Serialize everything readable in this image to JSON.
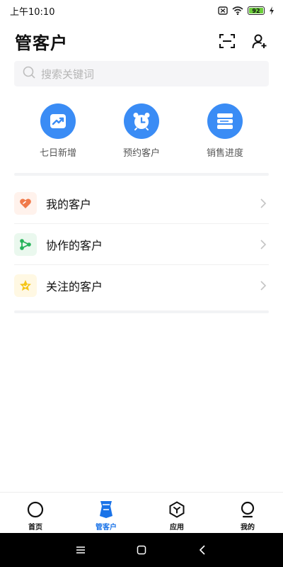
{
  "status_bar": {
    "time": "上午10:10",
    "battery": "92"
  },
  "header": {
    "title": "管客户"
  },
  "search": {
    "placeholder": "搜索关键词"
  },
  "quick_actions": [
    {
      "label": "七日新增",
      "icon": "trend-chart-icon"
    },
    {
      "label": "预约客户",
      "icon": "alarm-clock-icon"
    },
    {
      "label": "销售进度",
      "icon": "layers-icon"
    }
  ],
  "list": [
    {
      "label": "我的客户",
      "icon": "heart-tag-icon",
      "icon_color": "#f07a4b",
      "icon_bg": "#fff2ec"
    },
    {
      "label": "协作的客户",
      "icon": "share-nodes-icon",
      "icon_color": "#27b35a",
      "icon_bg": "#eaf8ee"
    },
    {
      "label": "关注的客户",
      "icon": "star-icon",
      "icon_color": "#f5c518",
      "icon_bg": "#fff8e3"
    }
  ],
  "bottom_nav": [
    {
      "label": "首页",
      "icon": "home-circle-icon",
      "active": false
    },
    {
      "label": "管客户",
      "icon": "customer-badge-icon",
      "active": true
    },
    {
      "label": "应用",
      "icon": "hexagon-apps-icon",
      "active": false
    },
    {
      "label": "我的",
      "icon": "profile-icon",
      "active": false
    }
  ],
  "colors": {
    "accent": "#3a8cf5",
    "active_nav": "#1a73e8"
  }
}
